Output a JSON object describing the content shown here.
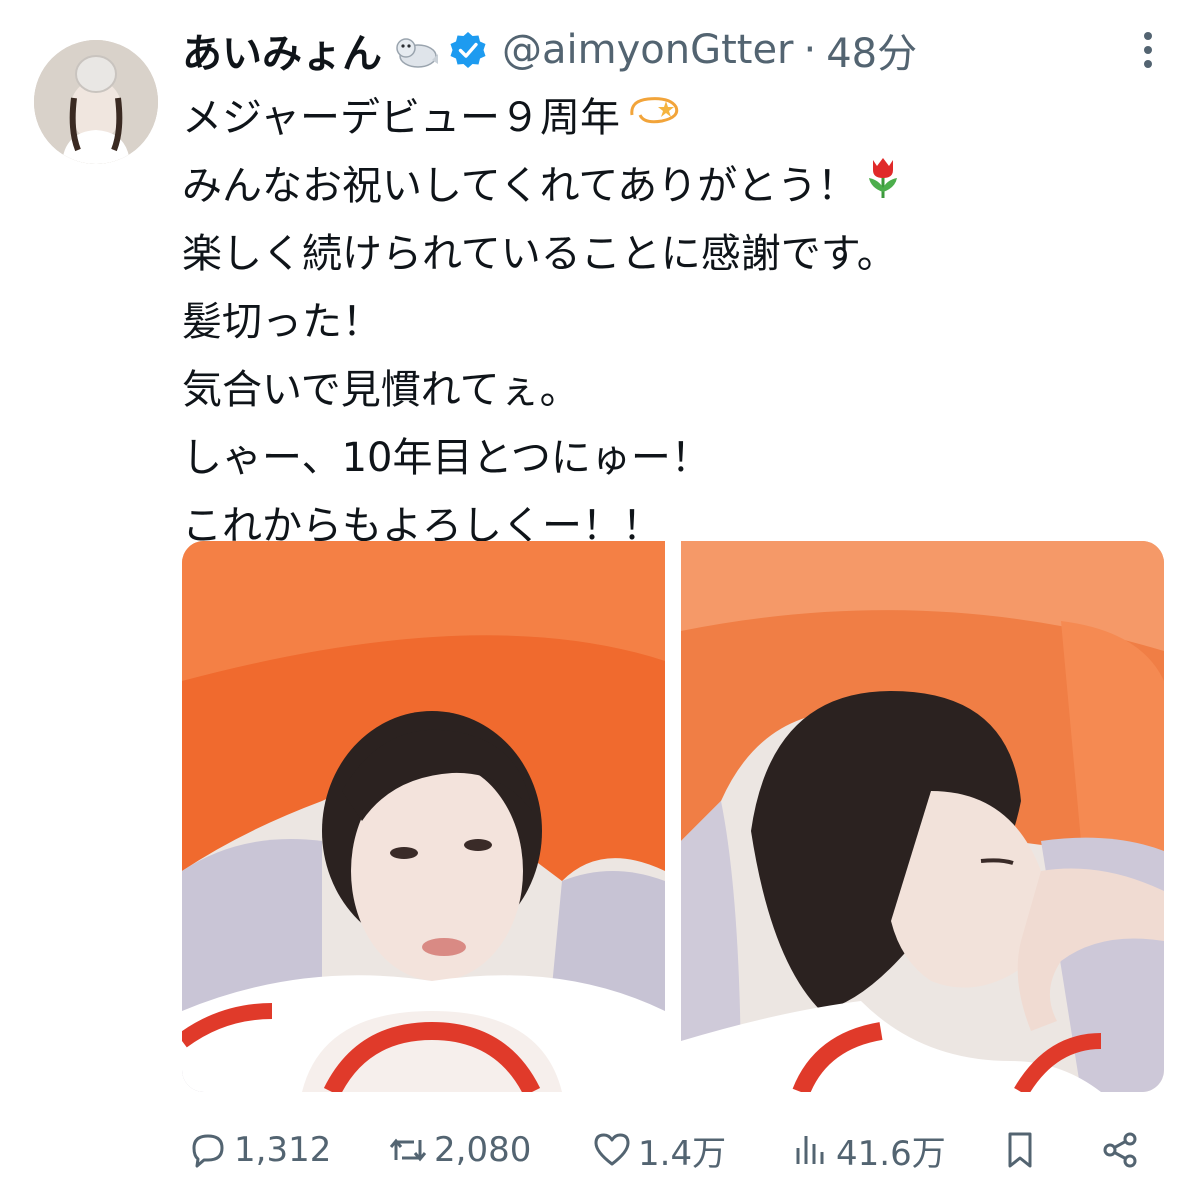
{
  "tweet": {
    "display_name": "あいみょん",
    "handle": "@aimyonGtter",
    "separator": "·",
    "timestamp": "48分",
    "icons": {
      "name_badge": "seal-emoji-icon",
      "verified": "verified-badge-icon",
      "more": "more-options-icon"
    },
    "lines": [
      "メジャーデビュー９周年",
      "みんなお祝いしてくれてありがとう！",
      "楽しく続けられていることに感謝です。",
      "髪切った！",
      "気合いで見慣れてぇ。",
      "しゃー、10年目とつにゅー！",
      "これからもよろしくー！！"
    ],
    "line_emojis": {
      "0": "dizzy-star-icon",
      "1": "tulip-icon"
    },
    "media": [
      {
        "name": "photo-1",
        "description_icon": "portrait-photo"
      },
      {
        "name": "photo-2",
        "description_icon": "portrait-photo"
      }
    ]
  },
  "actions": {
    "reply_count": "1,312",
    "retweet_count": "2,080",
    "like_count": "1.4万",
    "views_count": "41.6万"
  },
  "colors": {
    "text_primary": "#0f1419",
    "text_secondary": "#536471",
    "verified_blue": "#1d9bf0",
    "pillow_orange": "#f06a2e",
    "shirt_red": "#e03a2a"
  }
}
